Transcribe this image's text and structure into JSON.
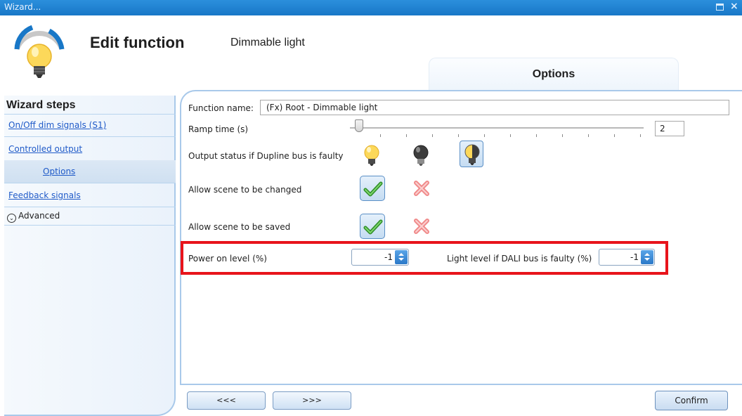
{
  "window": {
    "title": "Wizard..."
  },
  "header": {
    "title": "Edit function",
    "subtitle": "Dimmable light"
  },
  "tabs": [
    {
      "label": "Options",
      "selected": true
    }
  ],
  "sidebar": {
    "heading": "Wizard steps",
    "items": [
      {
        "label": "On/Off dim signals (S1)"
      },
      {
        "label": "Controlled output"
      },
      {
        "label": "Options",
        "active": true
      },
      {
        "label": "Feedback signals"
      }
    ],
    "advanced_label": "Advanced"
  },
  "form": {
    "function_name": {
      "label": "Function name:",
      "value": "(Fx) Root - Dimmable light"
    },
    "ramp_time": {
      "label": "Ramp time (s)",
      "value": "2",
      "slider_fraction": 0.03
    },
    "output_status": {
      "label": "Output status if Dupline bus is faulty",
      "options": [
        {
          "icon": "bulb-on-icon",
          "selected": false
        },
        {
          "icon": "bulb-off-icon",
          "selected": false
        },
        {
          "icon": "bulb-half-icon",
          "selected": true
        }
      ]
    },
    "scene_changed": {
      "label": "Allow scene to be changed",
      "value": true
    },
    "scene_saved": {
      "label": "Allow scene to be saved",
      "value": true
    },
    "power_on_level": {
      "label": "Power on level (%)",
      "value": "-1"
    },
    "dali_faulty_level": {
      "label": "Light level if DALI bus is faulty (%)",
      "value": "-1"
    }
  },
  "footer": {
    "prev_label": "<<<",
    "next_label": ">>>",
    "confirm_label": "Confirm"
  },
  "colors": {
    "titlebar": "#1877c7",
    "accent": "#a9c9ea",
    "highlight": "#e8141b",
    "link": "#1f5ac8"
  }
}
